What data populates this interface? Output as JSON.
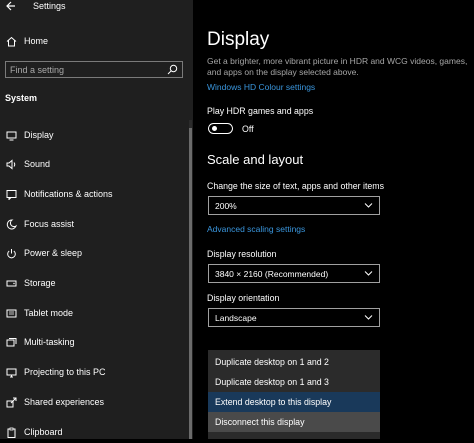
{
  "window": {
    "title": "Settings"
  },
  "sidebar": {
    "home_label": "Home",
    "search_placeholder": "Find a setting",
    "section_title": "System",
    "items": [
      {
        "label": "Display",
        "icon": "monitor-icon"
      },
      {
        "label": "Sound",
        "icon": "speaker-icon"
      },
      {
        "label": "Notifications & actions",
        "icon": "notification-icon"
      },
      {
        "label": "Focus assist",
        "icon": "moon-icon"
      },
      {
        "label": "Power & sleep",
        "icon": "power-icon"
      },
      {
        "label": "Storage",
        "icon": "storage-icon"
      },
      {
        "label": "Tablet mode",
        "icon": "tablet-icon"
      },
      {
        "label": "Multi-tasking",
        "icon": "multitasking-icon"
      },
      {
        "label": "Projecting to this PC",
        "icon": "projector-icon"
      },
      {
        "label": "Shared experiences",
        "icon": "share-icon"
      },
      {
        "label": "Clipboard",
        "icon": "clipboard-icon"
      }
    ]
  },
  "main": {
    "title": "Display",
    "description": "Get a brighter, more vibrant picture in HDR and WCG videos, games, and apps on the display selected above.",
    "hdr_link": "Windows HD Colour settings",
    "hdr_toggle_label": "Play HDR games and apps",
    "hdr_toggle_state": "Off",
    "scale_heading": "Scale and layout",
    "scale_label": "Change the size of text, apps and other items",
    "scale_value": "200%",
    "advanced_link": "Advanced scaling settings",
    "resolution_label": "Display resolution",
    "resolution_value": "3840 × 2160 (Recommended)",
    "orientation_label": "Display orientation",
    "orientation_value": "Landscape",
    "multiple_displays_menu": [
      "Duplicate desktop on 1 and 2",
      "Duplicate desktop on 1 and 3",
      "Extend desktop to this display",
      "Disconnect this display"
    ]
  },
  "colors": {
    "accent": "#3a96dd",
    "selected": "#19395a",
    "sidebar_bg": "#1f1f1f"
  }
}
